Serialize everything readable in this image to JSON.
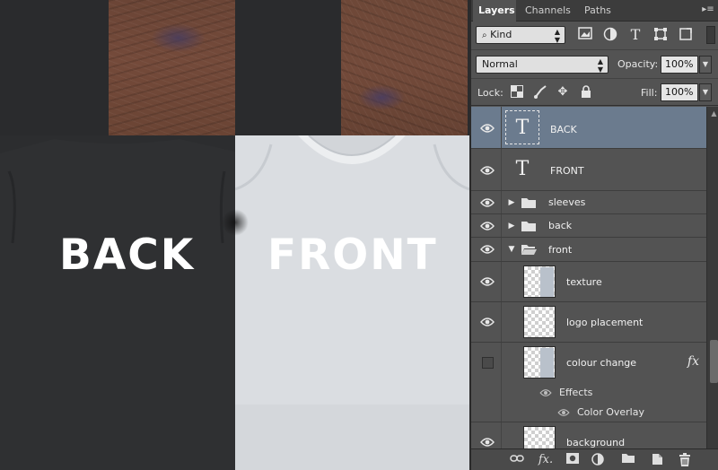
{
  "canvas": {
    "label_back": "BACK",
    "label_front": "FRONT"
  },
  "panel": {
    "tabs": [
      {
        "label": "Layers",
        "active": true
      },
      {
        "label": "Channels",
        "active": false
      },
      {
        "label": "Paths",
        "active": false
      }
    ],
    "filter": {
      "kind_label": "Kind",
      "icons": [
        "pixel-filter-icon",
        "adjustment-filter-icon",
        "type-filter-icon",
        "shape-filter-icon",
        "smart-object-filter-icon"
      ]
    },
    "blend": {
      "mode": "Normal",
      "opacity_label": "Opacity:",
      "opacity_value": "100%"
    },
    "lock": {
      "label": "Lock:",
      "fill_label": "Fill:",
      "fill_value": "100%",
      "icons": [
        "lock-transparent-icon",
        "lock-image-icon",
        "lock-position-icon",
        "lock-all-icon"
      ]
    },
    "layers": [
      {
        "name": "BACK",
        "type": "text",
        "visible": true,
        "selected": true
      },
      {
        "name": "FRONT",
        "type": "text",
        "visible": true,
        "selected": false
      },
      {
        "name": "sleeves",
        "type": "group",
        "visible": true,
        "expanded": false
      },
      {
        "name": "back",
        "type": "group",
        "visible": true,
        "expanded": false
      },
      {
        "name": "front",
        "type": "group",
        "visible": true,
        "expanded": true
      },
      {
        "name": "texture",
        "type": "pixel",
        "visible": true
      },
      {
        "name": "logo placement",
        "type": "pixel",
        "visible": true
      },
      {
        "name": "colour change",
        "type": "pixel",
        "visible": false,
        "fx": "fx"
      },
      {
        "name": "background",
        "type": "pixel",
        "visible": true
      }
    ],
    "effects": {
      "label": "Effects",
      "items": [
        "Color Overlay"
      ]
    },
    "footer_icons": [
      "link-layers-icon",
      "fx-icon",
      "add-mask-icon",
      "adjustment-layer-icon",
      "new-group-icon",
      "new-layer-icon",
      "delete-layer-icon"
    ]
  },
  "colors": {
    "selected_layer": "#6b7b8e",
    "panel_bg": "#535353",
    "front_shirt": "#d6d9dd"
  }
}
